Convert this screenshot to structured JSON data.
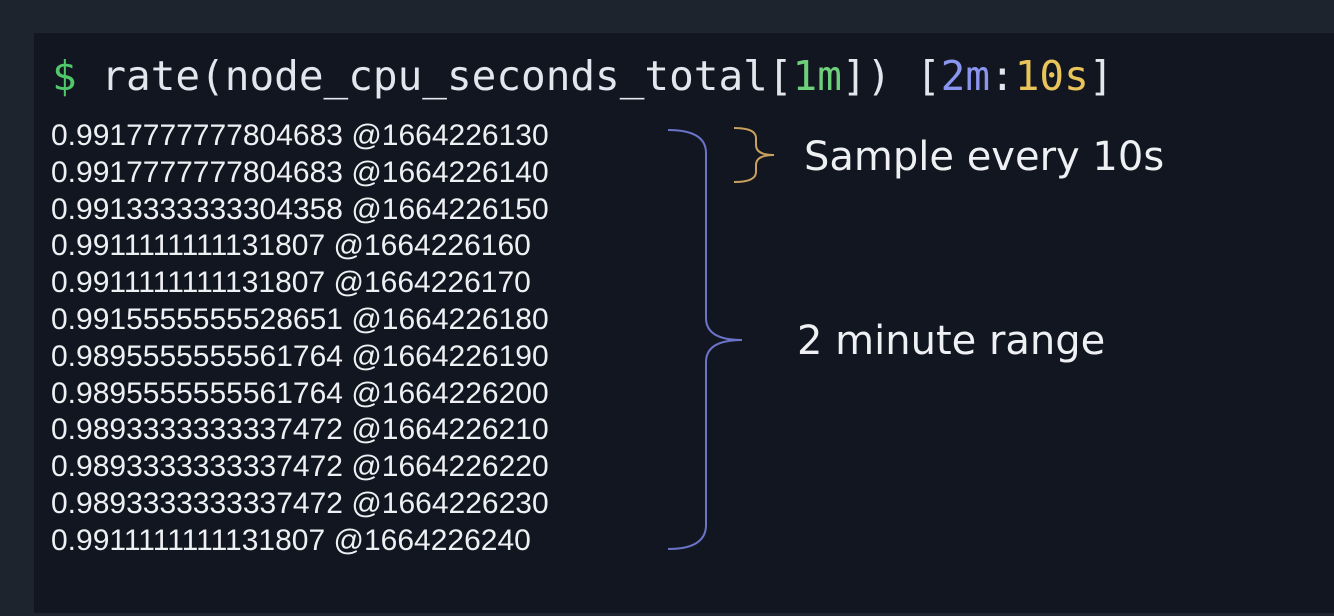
{
  "command": {
    "prompt": "$",
    "parts": {
      "p1": "rate(node_cpu_seconds_total[",
      "range": "1m",
      "p2": "]) [",
      "subquery_range": "2m",
      "colon": ":",
      "resolution": "10s",
      "p3": "]"
    }
  },
  "samples": [
    {
      "value": "0.9917777777804683",
      "timestamp": "@1664226130"
    },
    {
      "value": "0.9917777777804683",
      "timestamp": "@1664226140"
    },
    {
      "value": "0.9913333333304358",
      "timestamp": "@1664226150"
    },
    {
      "value": "0.9911111111131807",
      "timestamp": "@1664226160"
    },
    {
      "value": "0.9911111111131807",
      "timestamp": "@1664226170"
    },
    {
      "value": "0.9915555555528651",
      "timestamp": "@1664226180"
    },
    {
      "value": "0.9895555555561764",
      "timestamp": "@1664226190"
    },
    {
      "value": "0.9895555555561764",
      "timestamp": "@1664226200"
    },
    {
      "value": "0.9893333333337472",
      "timestamp": "@1664226210"
    },
    {
      "value": "0.9893333333337472",
      "timestamp": "@1664226220"
    },
    {
      "value": "0.9893333333337472",
      "timestamp": "@1664226230"
    },
    {
      "value": "0.9911111111131807",
      "timestamp": "@1664226240"
    }
  ],
  "annotations": {
    "sample_label": "Sample every 10s",
    "range_label": "2 minute range"
  },
  "colors": {
    "background": "#1d242e",
    "terminal": "#121620",
    "prompt": "#4fc76a",
    "range_green": "#6fd07c",
    "subquery_blue": "#8a95f0",
    "resolution_yellow": "#e8c45a",
    "sample_brace": "#c9a15e",
    "range_brace": "#6b74c8"
  }
}
